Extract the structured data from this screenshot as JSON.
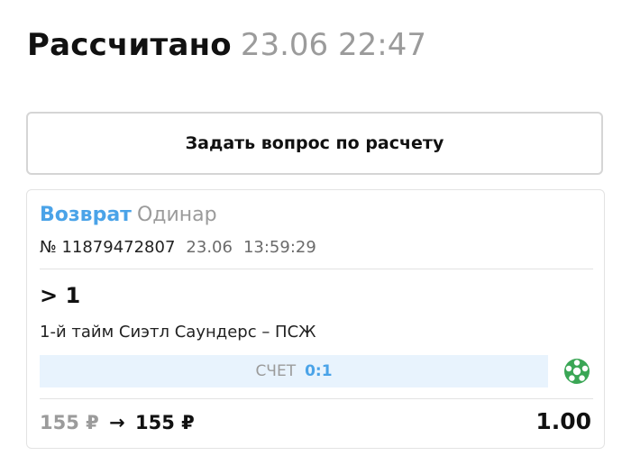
{
  "header": {
    "title": "Рассчитано",
    "datetime": "23.06 22:47"
  },
  "ask_button": {
    "label": "Задать вопрос по расчету"
  },
  "bet": {
    "status": "Возврат",
    "kind": "Одинар",
    "number": "№ 11879472807",
    "date": "23.06",
    "time": "13:59:29",
    "outcome": "> 1",
    "event": "1-й тайм Сиэтл Саундерс – ПСЖ",
    "score_label": "СЧЕТ",
    "score_value": "0:1",
    "sport_icon": "soccer-ball-icon",
    "stake": "155 ₽",
    "arrow": "→",
    "payout": "155 ₽",
    "odds": "1.00"
  },
  "colors": {
    "accent": "#4aa3e8",
    "muted": "#9b9b9b",
    "score_bg": "#e8f3fd",
    "soccer_icon": "#3aa655"
  }
}
